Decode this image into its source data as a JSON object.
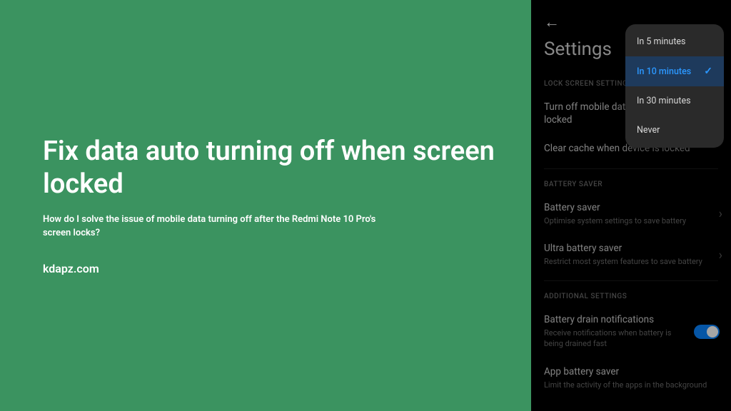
{
  "left": {
    "headline": "Fix data auto turning off when screen locked",
    "subhead": "How do I solve the issue of mobile data turning off after the Redmi Note 10 Pro's screen locks?",
    "site": "kdapz.com"
  },
  "phone": {
    "title": "Settings",
    "sections": {
      "lock_screen": {
        "label": "LOCK SCREEN SETTINGS",
        "item1": "Turn off mobile data when device is locked",
        "item2": "Clear cache when device is locked"
      },
      "battery_saver": {
        "label": "BATTERY SAVER",
        "item1": {
          "title": "Battery saver",
          "sub": "Optimise system settings to save battery"
        },
        "item2": {
          "title": "Ultra battery saver",
          "sub": "Restrict most system features to save battery"
        }
      },
      "additional": {
        "label": "ADDITIONAL SETTINGS",
        "item1": {
          "title": "Battery drain notifications",
          "sub": "Receive notifications when battery is being drained fast"
        },
        "item2": {
          "title": "App battery saver",
          "sub": "Limit the activity of the apps in the background"
        }
      }
    },
    "popup": {
      "opt1": "In 5 minutes",
      "opt2": "In 10 minutes",
      "opt3": "In 30 minutes",
      "opt4": "Never"
    }
  }
}
